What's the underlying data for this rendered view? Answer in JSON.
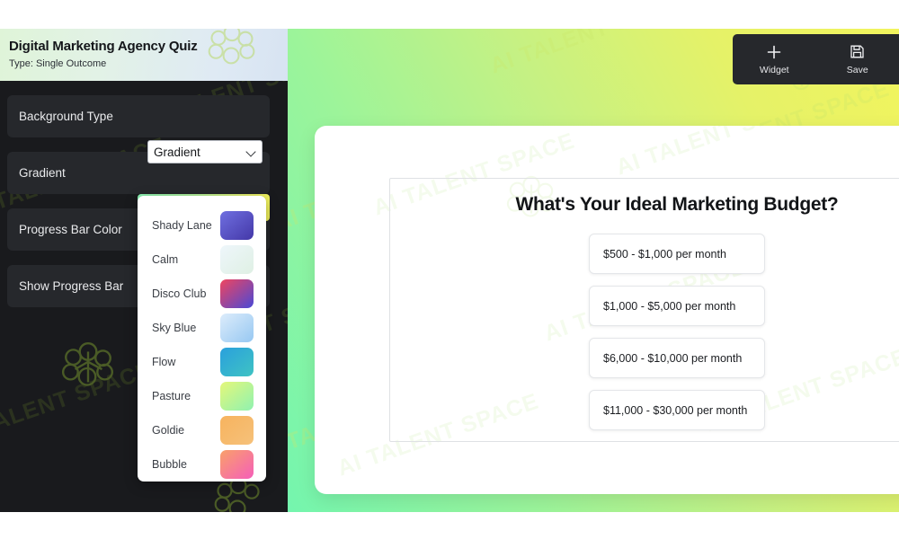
{
  "quiz": {
    "title": "Digital Marketing Agency Quiz",
    "subtitle": "Type: Single Outcome"
  },
  "sidebar": {
    "rows": [
      {
        "label": "Background Type"
      },
      {
        "label": "Gradient"
      },
      {
        "label": "Progress Bar Color"
      },
      {
        "label": "Show Progress Bar"
      }
    ],
    "background_type_select": {
      "value": "Gradient",
      "icon": "chevron-down-icon"
    },
    "gradient_swatch": {
      "from": "#8cf5b6",
      "to": "#f3f35a"
    }
  },
  "gradient_menu": {
    "options": [
      {
        "name": "Shady Lane",
        "from": "#6f6fe0",
        "to": "#4438a8"
      },
      {
        "name": "Calm",
        "from": "#eef6fb",
        "to": "#dff0e4"
      },
      {
        "name": "Disco Club",
        "from": "#f0455f",
        "to": "#4a49d6"
      },
      {
        "name": "Sky Blue",
        "from": "#dcecfb",
        "to": "#97c8f2"
      },
      {
        "name": "Flow",
        "from": "#2aa0dd",
        "to": "#3fc3c3"
      },
      {
        "name": "Pasture",
        "from": "#e4f77a",
        "to": "#8ff2b0"
      },
      {
        "name": "Goldie",
        "from": "#f7b35e",
        "to": "#f6c17a"
      },
      {
        "name": "Bubble",
        "from": "#f9a06a",
        "to": "#f55fb9"
      }
    ]
  },
  "toolbar": {
    "widget_label": "Widget",
    "widget_icon": "plus-icon",
    "save_label": "Save",
    "save_icon": "floppy-disk-icon"
  },
  "question": {
    "title": "What's Your Ideal Marketing Budget?",
    "answers": [
      "$500 - $1,000 per month",
      "$1,000 - $5,000 per month",
      "$6,000 - $10,000 per month",
      "$11,000 - $30,000 per month"
    ]
  },
  "canvas": {
    "background_from": "#74f5ae",
    "background_to": "#f2f45d"
  },
  "watermark": {
    "text": "AI TALENT SPACE"
  }
}
